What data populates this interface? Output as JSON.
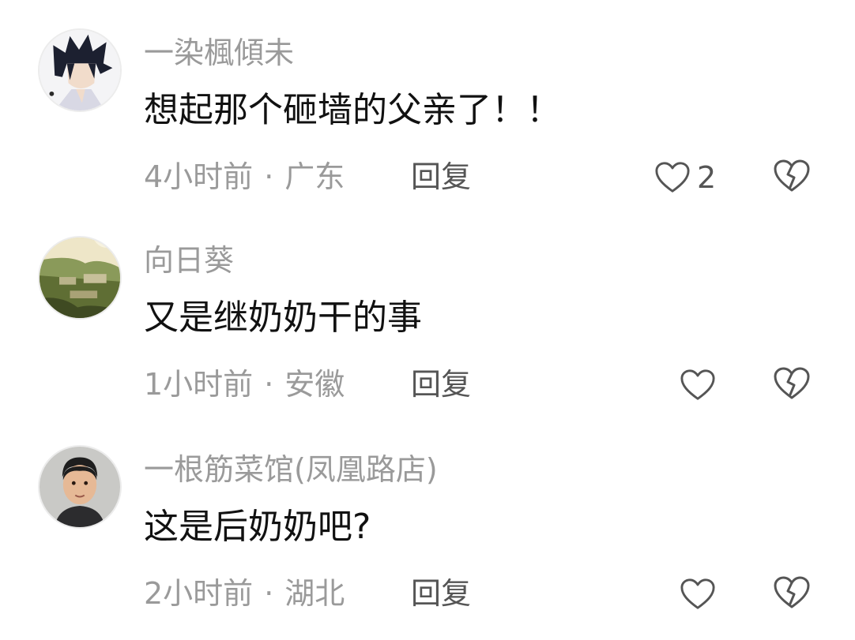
{
  "comments": [
    {
      "username": "一染楓傾未",
      "text": "想起那个砸墙的父亲了！！",
      "time": "4小时前",
      "separator": "·",
      "location": "广东",
      "reply_label": "回复",
      "likes": "2",
      "avatar_icon": "anime-character-avatar"
    },
    {
      "username": "向日葵",
      "text": "又是继奶奶干的事",
      "time": "1小时前",
      "separator": "·",
      "location": "安徽",
      "reply_label": "回复",
      "avatar_icon": "landscape-avatar"
    },
    {
      "username": "一根筋菜馆(凤凰路店)",
      "text": "这是后奶奶吧?",
      "time": "2小时前",
      "separator": "·",
      "location": "湖北",
      "reply_label": "回复",
      "avatar_icon": "man-portrait-avatar"
    }
  ],
  "colors": {
    "username": "#9a9a9a",
    "text": "#111111",
    "meta": "#9a9a9a",
    "action": "#555555",
    "icon": "#555555"
  }
}
